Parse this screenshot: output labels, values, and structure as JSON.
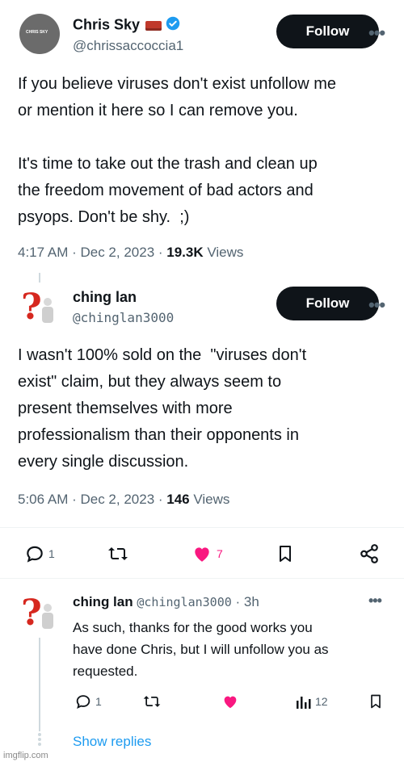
{
  "tweet1": {
    "author_name": "Chris Sky",
    "author_handle": "@chrissaccoccia1",
    "avatar_caption": "CHRIS SKY",
    "follow_label": "Follow",
    "more_label": "•••",
    "text": "If you believe viruses don't exist unfollow me\nor mention it here so I can remove you.\n\nIt's time to take out the trash and clean up\nthe freedom movement of bad actors and\npsyops. Don't be shy.  ;)",
    "time": "4:17 AM · Dec 2, 2023 · ",
    "views_count": "19.3K",
    "views_label": " Views"
  },
  "tweet2": {
    "author_name": "ching lan",
    "author_handle": "@chinglan3000",
    "follow_label": "Follow",
    "more_label": "•••",
    "text": "I wasn't 100% sold on the  \"viruses don't\nexist\" claim, but they always seem to\npresent themselves with more\nprofessionalism than their opponents in\nevery single discussion.",
    "time": "5:06 AM · Dec 2, 2023 · ",
    "views_count": "146",
    "views_label": " Views",
    "actions": {
      "reply_count": "1",
      "like_count": "7"
    }
  },
  "reply": {
    "author_name": "ching lan",
    "author_handle": "@chinglan3000",
    "age": "· 3h",
    "more_label": "•••",
    "text": "As such, thanks for the good works you\nhave done Chris, but I will unfollow you as\nrequested.",
    "actions": {
      "reply_count": "1",
      "views_count": "12"
    },
    "show_replies": "Show replies"
  },
  "watermark": "imgflip.com",
  "colors": {
    "verified": "#1d9bf0",
    "like": "#f91880",
    "link": "#1d9bf0",
    "muted": "#536471"
  }
}
